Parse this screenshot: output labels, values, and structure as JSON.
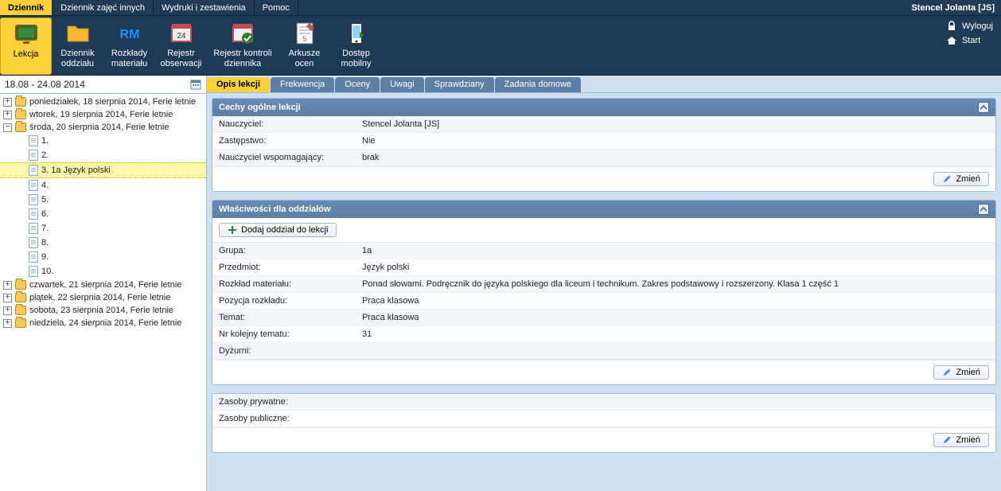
{
  "user_name": "Stencel Jolanta [JS]",
  "right_links": {
    "logout": "Wyloguj",
    "start": "Start"
  },
  "top_tabs": [
    {
      "label": "Dziennik",
      "active": true
    },
    {
      "label": "Dziennik zajęć innych"
    },
    {
      "label": "Wydruki i zestawienia"
    },
    {
      "label": "Pomoc"
    }
  ],
  "ribbon": [
    {
      "label": "Lekcja",
      "active": true,
      "icon": "board"
    },
    {
      "label": "Dziennik oddziału",
      "icon": "folder"
    },
    {
      "label": "Rozkłady materiału",
      "icon": "rm"
    },
    {
      "label": "Rejestr obserwacji",
      "icon": "box"
    },
    {
      "label": "Rejestr kontroli dziennika",
      "icon": "check",
      "wide": true
    },
    {
      "label": "Arkusze ocen",
      "icon": "sheet"
    },
    {
      "label": "Dostęp mobilny",
      "icon": "mobile"
    }
  ],
  "sidebar_title": "18.08 - 24.08 2014",
  "tree": {
    "days": [
      {
        "label": "poniedziałek, 18 sierpnia 2014, Ferie letnie",
        "state": "plus"
      },
      {
        "label": "wtorek, 19 sierpnia 2014, Ferie letnie",
        "state": "plus"
      },
      {
        "label": "środa, 20 sierpnia 2014, Ferie letnie",
        "state": "minus",
        "children": [
          {
            "label": "1."
          },
          {
            "label": "2."
          },
          {
            "label": "3. 1a Język polski",
            "selected": true
          },
          {
            "label": "4."
          },
          {
            "label": "5."
          },
          {
            "label": "6."
          },
          {
            "label": "7."
          },
          {
            "label": "8."
          },
          {
            "label": "9."
          },
          {
            "label": "10."
          }
        ]
      },
      {
        "label": "czwartek, 21 sierpnia 2014, Ferie letnie",
        "state": "plus"
      },
      {
        "label": "piątek, 22 sierpnia 2014, Ferie letnie",
        "state": "plus"
      },
      {
        "label": "sobota, 23 sierpnia 2014, Ferie letnie",
        "state": "plus"
      },
      {
        "label": "niedziela, 24 sierpnia 2014, Ferie letnie",
        "state": "plus"
      }
    ]
  },
  "inner_tabs": [
    {
      "label": "Opis lekcji",
      "active": true
    },
    {
      "label": "Frekwencja"
    },
    {
      "label": "Oceny"
    },
    {
      "label": "Uwagi"
    },
    {
      "label": "Sprawdziany"
    },
    {
      "label": "Zadania domowe"
    }
  ],
  "panel1": {
    "title": "Cechy ogólne lekcji",
    "rows": [
      {
        "label": "Nauczyciel:",
        "value": "Stencel Jolanta [JS]"
      },
      {
        "label": "Zastępstwo:",
        "value": "Nie"
      },
      {
        "label": "Nauczyciel wspomagający:",
        "value": "brak"
      }
    ],
    "change": "Zmień"
  },
  "panel2": {
    "title": "Właściwości dla oddziałów",
    "add_label": "Dodaj oddział do lekcji",
    "rows": [
      {
        "label": "Grupa:",
        "value": "1a"
      },
      {
        "label": "Przedmiot:",
        "value": "Język polski"
      },
      {
        "label": "Rozkład materiału:",
        "value": "Ponad słowami. Podręcznik do języka polskiego dla liceum i technikum. Zakres podstawowy i rozszerzony. Klasa 1 część 1"
      },
      {
        "label": "Pozycja rozkładu:",
        "value": "Praca klasowa"
      },
      {
        "label": "Temat:",
        "value": "Praca klasowa"
      },
      {
        "label": "Nr kolejny tematu:",
        "value": "31"
      },
      {
        "label": "Dyżurni:",
        "value": ""
      }
    ],
    "change": "Zmień"
  },
  "panel3": {
    "rows": [
      {
        "label": "Zasoby prywatne:",
        "value": ""
      },
      {
        "label": "Zasoby publiczne:",
        "value": ""
      }
    ],
    "change": "Zmień"
  }
}
